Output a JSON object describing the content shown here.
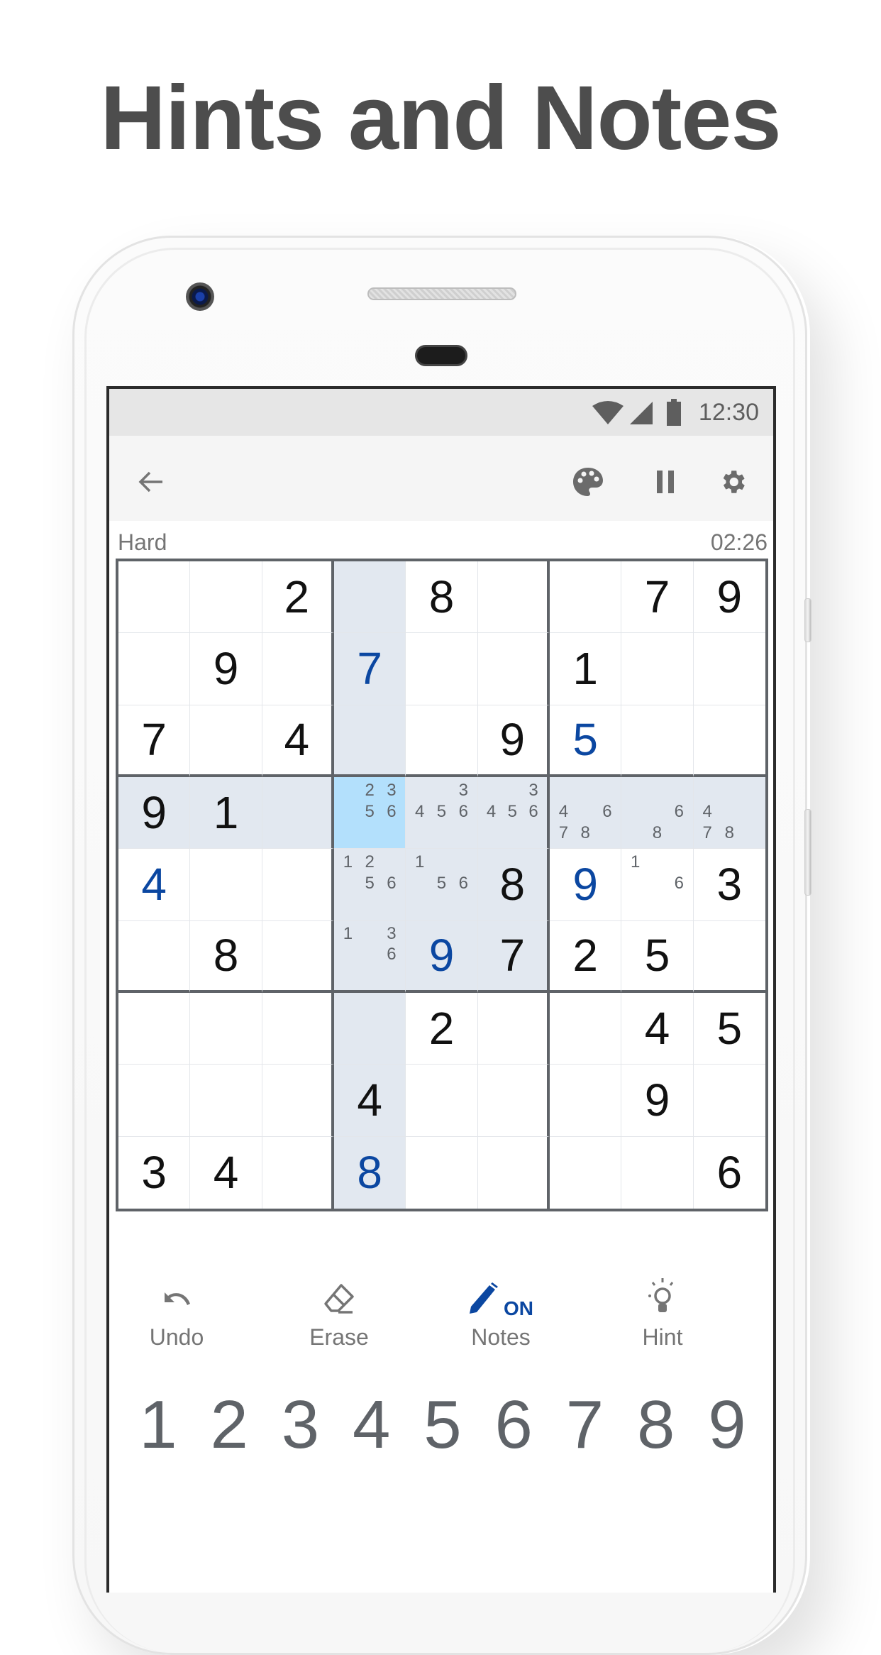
{
  "headline": "Hints and Notes",
  "status_bar": {
    "time": "12:30",
    "icons": [
      "wifi-icon",
      "cell-signal-icon",
      "battery-icon"
    ]
  },
  "toolbar": {
    "back_icon": "arrow-left-icon",
    "actions": [
      {
        "name": "theme",
        "icon": "palette-icon"
      },
      {
        "name": "pause",
        "icon": "pause-icon"
      },
      {
        "name": "settings",
        "icon": "gear-icon"
      }
    ]
  },
  "game": {
    "difficulty": "Hard",
    "timer": "02:26"
  },
  "board": {
    "selected": [
      3,
      3
    ],
    "highlight_row": 3,
    "highlight_col": 3,
    "highlight_box": [
      3,
      3
    ],
    "rows": [
      [
        {
          "v": ""
        },
        {
          "v": ""
        },
        {
          "v": "2"
        },
        {
          "v": ""
        },
        {
          "v": "8"
        },
        {
          "v": ""
        },
        {
          "v": ""
        },
        {
          "v": "7"
        },
        {
          "v": "9"
        }
      ],
      [
        {
          "v": ""
        },
        {
          "v": "9"
        },
        {
          "v": ""
        },
        {
          "v": "7",
          "user": true
        },
        {
          "v": ""
        },
        {
          "v": ""
        },
        {
          "v": "1"
        },
        {
          "v": ""
        },
        {
          "v": ""
        }
      ],
      [
        {
          "v": "7"
        },
        {
          "v": ""
        },
        {
          "v": "4"
        },
        {
          "v": ""
        },
        {
          "v": ""
        },
        {
          "v": "9"
        },
        {
          "v": "5",
          "user": true
        },
        {
          "v": ""
        },
        {
          "v": ""
        }
      ],
      [
        {
          "v": "9"
        },
        {
          "v": "1"
        },
        {
          "v": ""
        },
        {
          "v": "",
          "notes": [
            2,
            3,
            5,
            6
          ]
        },
        {
          "v": "",
          "notes": [
            3,
            4,
            5,
            6
          ]
        },
        {
          "v": "",
          "notes": [
            3,
            4,
            5,
            6
          ]
        },
        {
          "v": "",
          "notes": [
            4,
            6,
            7,
            8
          ]
        },
        {
          "v": "",
          "notes": [
            6,
            8
          ]
        },
        {
          "v": "",
          "notes": [
            4,
            7,
            8
          ]
        }
      ],
      [
        {
          "v": "4",
          "user": true
        },
        {
          "v": ""
        },
        {
          "v": ""
        },
        {
          "v": "",
          "notes": [
            1,
            2,
            5,
            6
          ]
        },
        {
          "v": "",
          "notes": [
            1,
            5,
            6
          ]
        },
        {
          "v": "8"
        },
        {
          "v": "9",
          "user": true
        },
        {
          "v": "",
          "notes": [
            1,
            6
          ]
        },
        {
          "v": "3"
        }
      ],
      [
        {
          "v": ""
        },
        {
          "v": "8"
        },
        {
          "v": ""
        },
        {
          "v": "",
          "notes": [
            1,
            3,
            6
          ]
        },
        {
          "v": "9",
          "user": true
        },
        {
          "v": "7"
        },
        {
          "v": "2"
        },
        {
          "v": "5"
        },
        {
          "v": ""
        }
      ],
      [
        {
          "v": ""
        },
        {
          "v": ""
        },
        {
          "v": ""
        },
        {
          "v": ""
        },
        {
          "v": "2"
        },
        {
          "v": ""
        },
        {
          "v": ""
        },
        {
          "v": "4"
        },
        {
          "v": "5"
        }
      ],
      [
        {
          "v": ""
        },
        {
          "v": ""
        },
        {
          "v": ""
        },
        {
          "v": "4"
        },
        {
          "v": ""
        },
        {
          "v": ""
        },
        {
          "v": ""
        },
        {
          "v": "9"
        },
        {
          "v": ""
        }
      ],
      [
        {
          "v": "3"
        },
        {
          "v": "4"
        },
        {
          "v": ""
        },
        {
          "v": "8",
          "user": true
        },
        {
          "v": ""
        },
        {
          "v": ""
        },
        {
          "v": ""
        },
        {
          "v": ""
        },
        {
          "v": "6"
        }
      ]
    ]
  },
  "actions": [
    {
      "label": "Undo",
      "icon": "undo-icon"
    },
    {
      "label": "Erase",
      "icon": "eraser-icon"
    },
    {
      "label": "Notes",
      "icon": "pencil-icon",
      "badge": "ON"
    },
    {
      "label": "Hint",
      "icon": "lightbulb-icon"
    }
  ],
  "numpad": [
    "1",
    "2",
    "3",
    "4",
    "5",
    "6",
    "7",
    "8",
    "9"
  ],
  "colors": {
    "accent": "#0b47a1",
    "highlight": "#e2e8f0",
    "selected": "#b3e0fc",
    "grid_line": "#5f6368"
  }
}
